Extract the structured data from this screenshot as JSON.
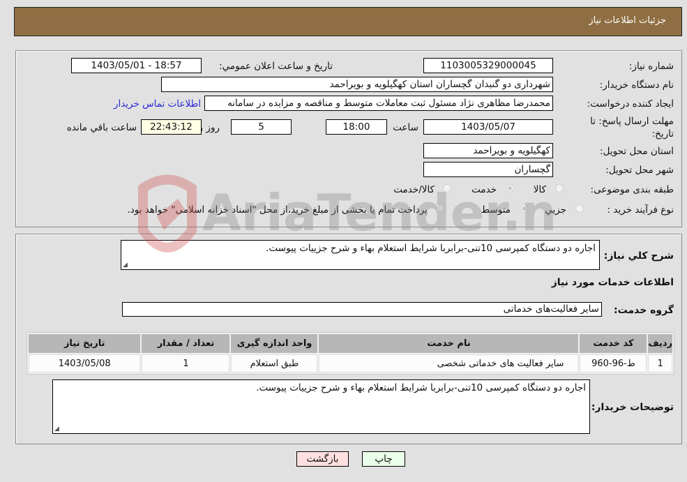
{
  "header": {
    "title": "جزئیات اطلاعات نیاز"
  },
  "fields": {
    "need_number": {
      "label": "شماره نیاز:",
      "value": "1103005329000045"
    },
    "announce_datetime": {
      "label": "تاریخ و ساعت اعلان عمومي:",
      "value": "1403/05/01 - 18:57"
    },
    "buyer_org": {
      "label": "نام دستگاه خريدار:",
      "value": "شهرداری دو گنبدان گچساران استان کهگیلویه و بویراحمد"
    },
    "requester": {
      "label": "ايجاد کننده درخواست:",
      "value": "محمدرضا مظاهری نژاد مسئول ثبت معاملات متوسط و مناقصه و مزایده در سامانه",
      "contact_link": "اطلاعات تماس خريدار"
    },
    "deadline": {
      "label": "مهلت ارسال پاسخ: تا تاريخ:",
      "date": "1403/05/07",
      "time_label": "ساعت",
      "time": "18:00",
      "days": "5",
      "days_label": "روز و",
      "remaining": "22:43:12",
      "remaining_label": "ساعت باقي مانده"
    },
    "delivery_province": {
      "label": "استان محل تحويل:",
      "value": "کهگیلویه و بویراحمد"
    },
    "delivery_city": {
      "label": "شهر محل تحويل:",
      "value": "گچساران"
    },
    "category": {
      "label": "طبقه بندی موضوعی:",
      "options": [
        "کالا",
        "خدمت",
        "کالا/خدمت"
      ],
      "selected": "خدمت"
    },
    "purchase_type": {
      "label": "نوع فرآيند خريد :",
      "options": [
        "جزيي",
        "متوسط"
      ],
      "selected": "متوسط",
      "treasury_note": "پرداخت تمام يا بخشی از مبلغ خريد،از محل \"اسناد خزانه اسلامی\" خواهد بود.",
      "treasury_checked": false
    }
  },
  "description": {
    "label": "شرح كلي نياز:",
    "value": "اجاره دو دستگاه کمپرسی 10تنی-برابربا شرایط استعلام بهاء و شرح جزییات پیوست."
  },
  "services_section": {
    "title": "اطلاعات خدمات مورد نياز",
    "group_label": "گروه خدمت:",
    "group_value": "سایر فعالیت‌های خدماتی"
  },
  "table": {
    "headers": [
      "رديف",
      "کد خدمت",
      "نام خدمت",
      "واحد اندازه گيری",
      "تعداد / مقدار",
      "تاريخ نياز"
    ],
    "rows": [
      [
        "1",
        "ط-96-960",
        "سایر فعالیت های خدماتی شخصی",
        "طبق استعلام",
        "1",
        "1403/05/08"
      ]
    ]
  },
  "buyer_notes": {
    "label": "توضيحات خريدار:",
    "value": "اجاره دو دستگاه کمپرسی 10تنی-برابربا شرایط استعلام بهاء و شرح جزییات پیوست."
  },
  "buttons": {
    "print": "چاپ",
    "back": "بازگشت"
  },
  "watermark": {
    "text": "AriaTender.neT"
  }
}
